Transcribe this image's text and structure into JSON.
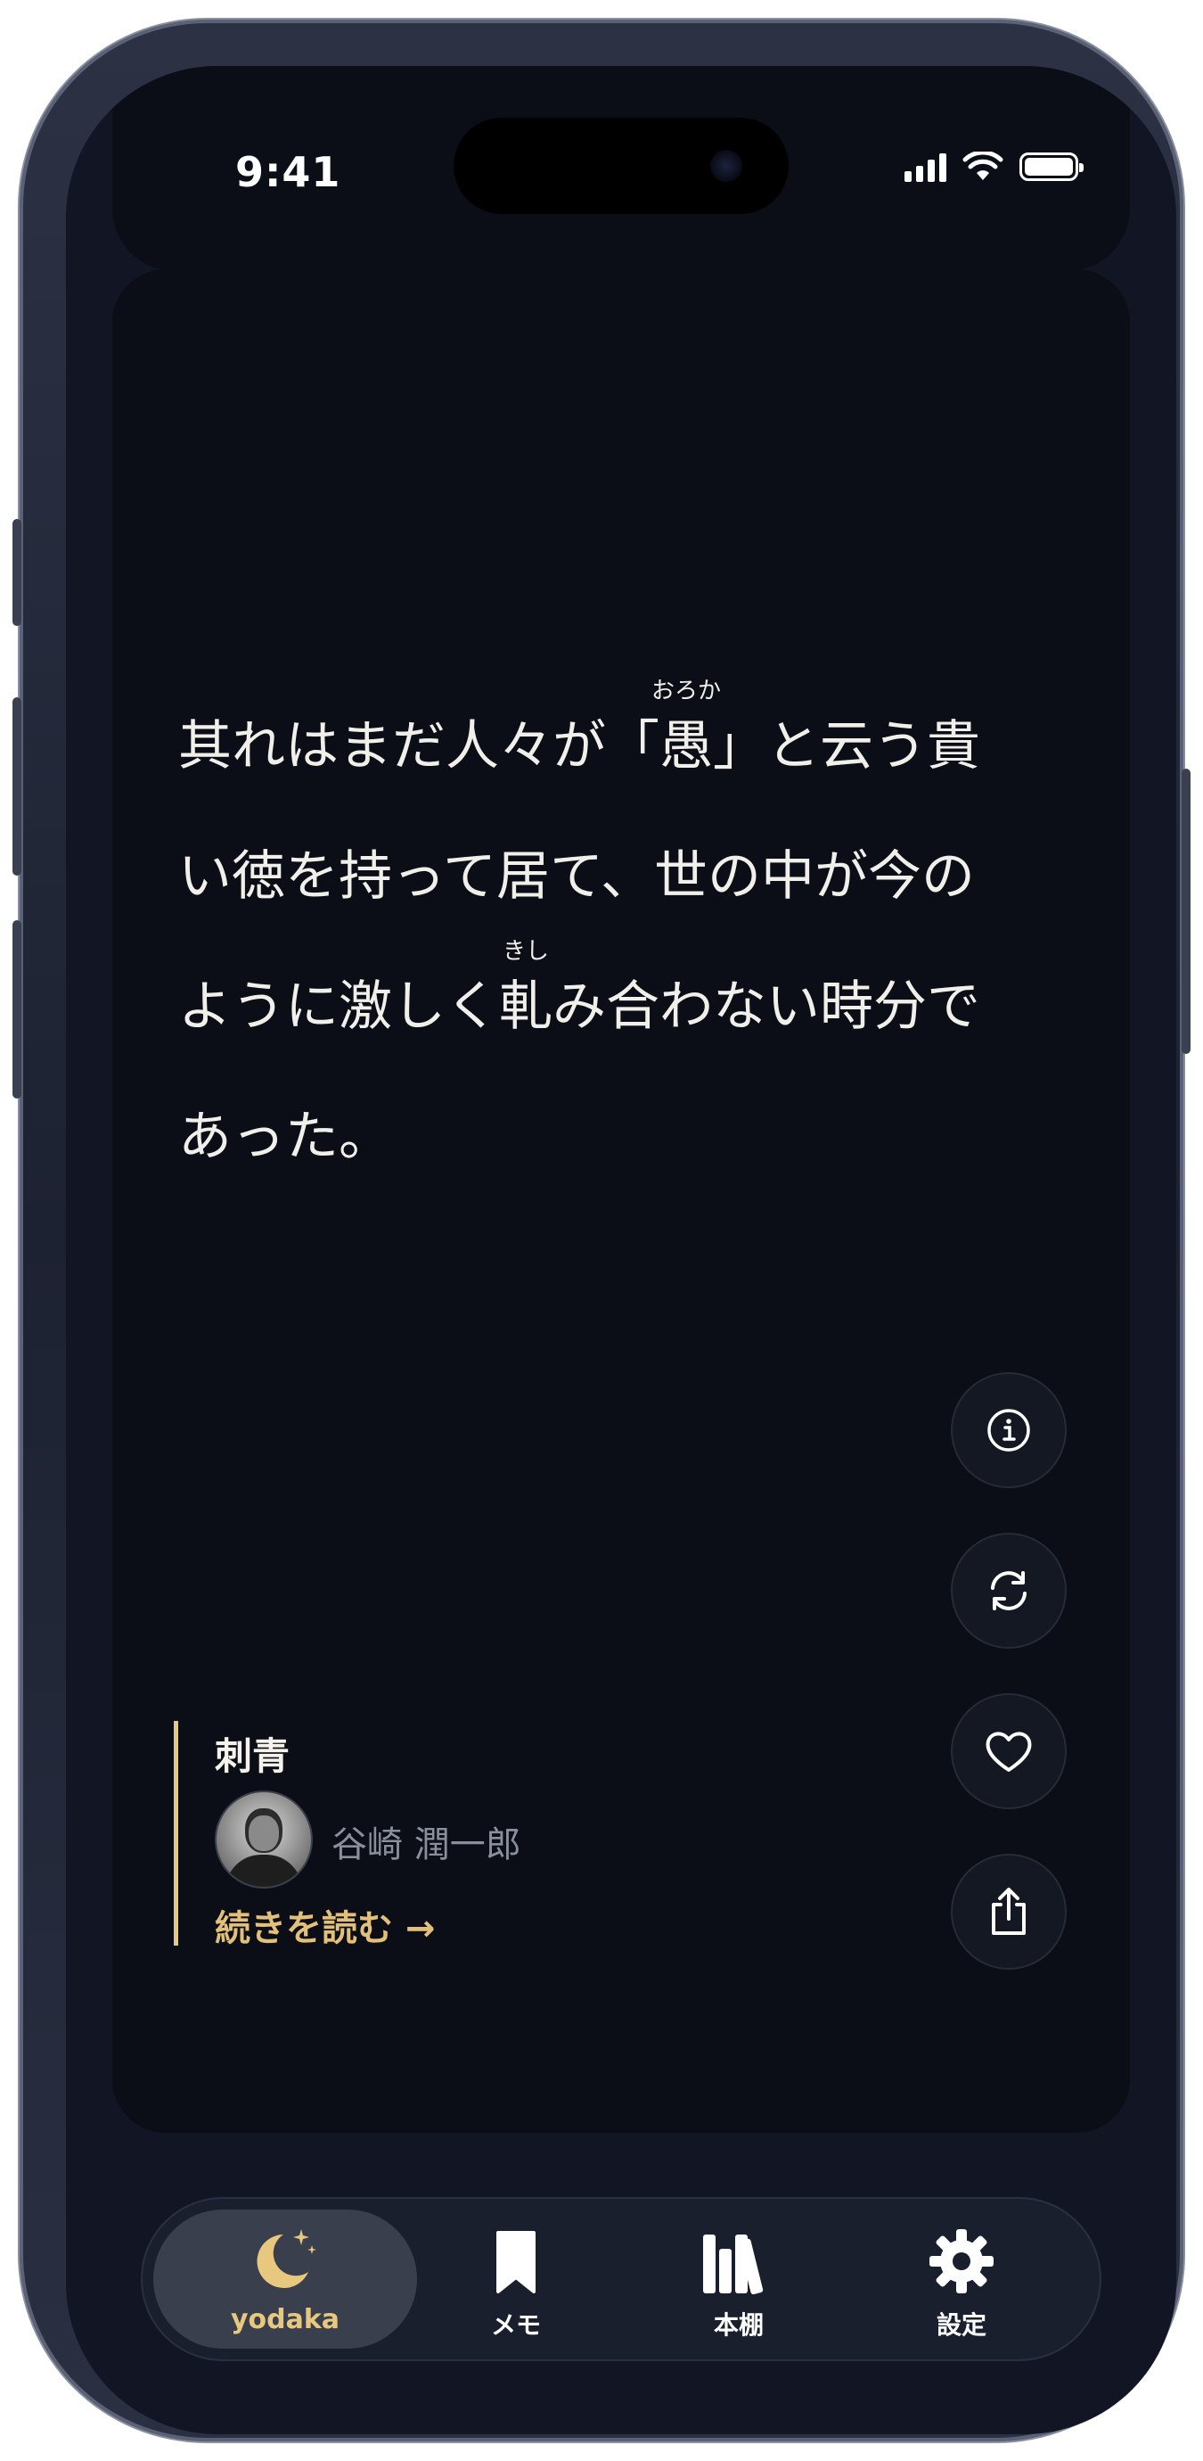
{
  "status_bar": {
    "time": "9:41"
  },
  "passage": {
    "lines": [
      {
        "pre": "其れはまだ人々が「",
        "ruby_base": "愚",
        "ruby_text": "おろか",
        "post": "」と云う貴"
      },
      {
        "pre": "い徳を持って居て、世の中が今の",
        "ruby_base": "",
        "ruby_text": "",
        "post": ""
      },
      {
        "pre": "ように激しく",
        "ruby_base": "軋",
        "ruby_text": "きし",
        "post": "み合わない時分で"
      },
      {
        "pre": "あった。",
        "ruby_base": "",
        "ruby_text": "",
        "post": ""
      }
    ]
  },
  "actions": [
    "info-icon",
    "refresh-icon",
    "heart-icon",
    "share-icon"
  ],
  "book": {
    "title": "刺青",
    "author": "谷崎 潤一郎",
    "read_more": "続きを読む →"
  },
  "tabbar": {
    "active": "yodaka",
    "tabs": [
      {
        "id": "yodaka",
        "label": "yodaka",
        "icon": "moon-sparkle-icon"
      },
      {
        "id": "memo",
        "label": "メモ",
        "icon": "bookmark-icon"
      },
      {
        "id": "bookshelf",
        "label": "本棚",
        "icon": "bookshelf-icon"
      },
      {
        "id": "settings",
        "label": "設定",
        "icon": "gear-icon"
      }
    ]
  },
  "colors": {
    "accent": "#e8c77e",
    "background": "#0b0e16",
    "text": "#f0efe9"
  }
}
